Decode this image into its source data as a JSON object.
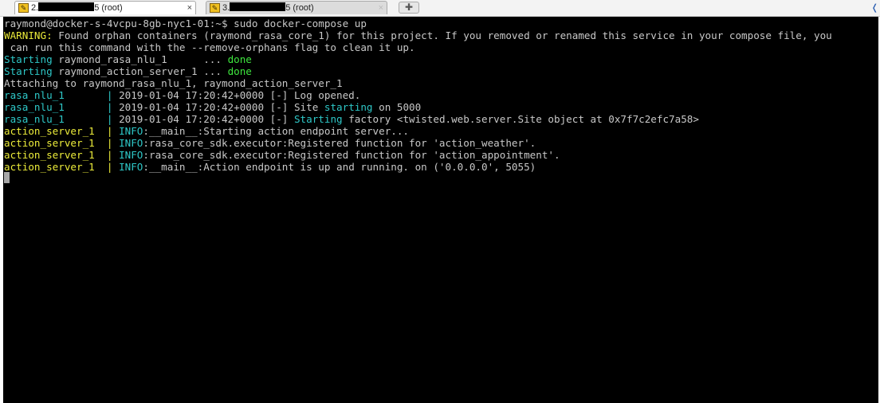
{
  "tabs": [
    {
      "prefix": "2.",
      "suffix": "5 (root)",
      "close": "×"
    },
    {
      "prefix": "3.",
      "suffix": "5 (root)",
      "close": "×"
    }
  ],
  "new_tab_icon": "plus-icon",
  "terminal": {
    "prompt_line": "raymond@docker-s-4vcpu-8gb-nyc1-01:~$ sudo docker-compose up",
    "warning_label": "WARNING:",
    "warning_text": " Found orphan containers (raymond_rasa_core_1) for this project. If you removed or renamed this service in your compose file, you",
    "warning_text2": " can run this command with the --remove-orphans flag to clean it up.",
    "starting_1_label": "Starting",
    "starting_1_name": " raymond_rasa_nlu_1      ... ",
    "starting_1_status": "done",
    "starting_2_label": "Starting",
    "starting_2_name": " raymond_action_server_1 ... ",
    "starting_2_status": "done",
    "attaching": "Attaching to raymond_rasa_nlu_1, raymond_action_server_1",
    "log1_src": "rasa_nlu_1       | ",
    "log1_msg": "2019-01-04 17:20:42+0000 [-] Log opened.",
    "log2_src": "rasa_nlu_1       | ",
    "log2_pre": "2019-01-04 17:20:42+0000 [-] Site ",
    "log2_kw": "starting",
    "log2_post": " on 5000",
    "log3_src": "rasa_nlu_1       | ",
    "log3_pre": "2019-01-04 17:20:42+0000 [-] ",
    "log3_kw": "Starting",
    "log3_post": " factory <twisted.web.server.Site object at 0x7f7c2efc7a58>",
    "log4_src": "action_server_1  | ",
    "log4_level": "INFO",
    "log4_msg": ":__main__:Starting action endpoint server...",
    "log5_src": "action_server_1  | ",
    "log5_level": "INFO",
    "log5_msg": ":rasa_core_sdk.executor:Registered function for 'action_weather'.",
    "log6_src": "action_server_1  | ",
    "log6_level": "INFO",
    "log6_msg": ":rasa_core_sdk.executor:Registered function for 'action_appointment'.",
    "log7_src": "action_server_1  | ",
    "log7_level": "INFO",
    "log7_msg": ":__main__:Action endpoint is up and running. on ('0.0.0.0', 5055)"
  }
}
